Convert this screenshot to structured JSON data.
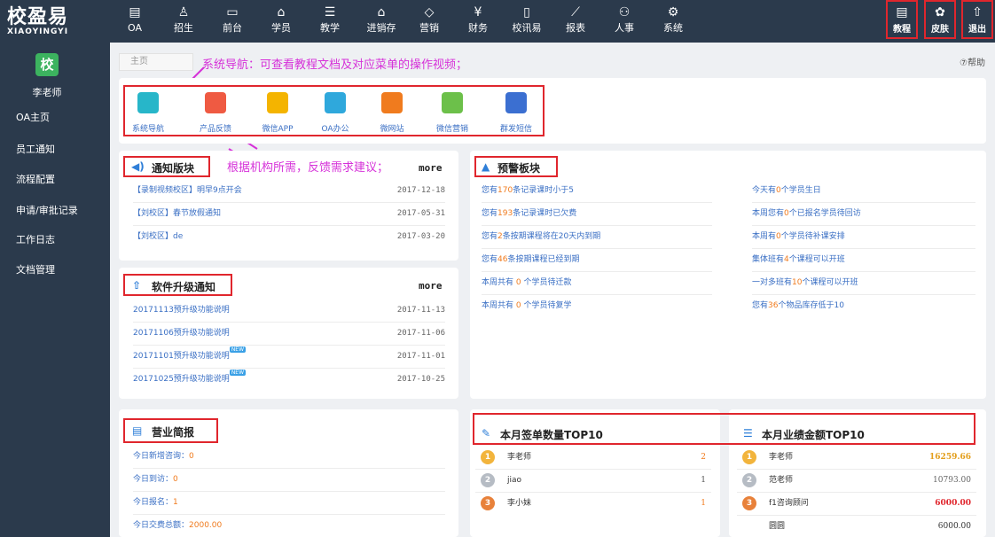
{
  "logo": {
    "name": "校盈易",
    "sub": "XIAOYINGYI"
  },
  "nav": [
    {
      "label": "OA",
      "icon": "contacts-icon"
    },
    {
      "label": "招生",
      "icon": "users-icon"
    },
    {
      "label": "前台",
      "icon": "monitor-icon"
    },
    {
      "label": "学员",
      "icon": "graduation-cap-icon"
    },
    {
      "label": "教学",
      "icon": "book-icon"
    },
    {
      "label": "进销存",
      "icon": "warehouse-icon"
    },
    {
      "label": "营销",
      "icon": "tag-icon"
    },
    {
      "label": "财务",
      "icon": "yen-icon"
    },
    {
      "label": "校讯易",
      "icon": "phone-icon"
    },
    {
      "label": "报表",
      "icon": "chart-icon"
    },
    {
      "label": "人事",
      "icon": "people-icon"
    },
    {
      "label": "系统",
      "icon": "gear-icon"
    }
  ],
  "right_buttons": [
    {
      "label": "教程",
      "icon": "tutorial-icon"
    },
    {
      "label": "皮肤",
      "icon": "palette-icon"
    },
    {
      "label": "退出",
      "icon": "logout-icon"
    }
  ],
  "sidebar": {
    "avatar": "校",
    "user": "李老师",
    "items": [
      "OA主页",
      "员工通知",
      "流程配置",
      "申请/审批记录",
      "工作日志",
      "文档管理"
    ]
  },
  "breadcrumb": "主页",
  "help": "⑦帮助",
  "annotations": {
    "top": "系统导航：可查看教程文档及对应菜单的操作视频；",
    "middle": "根据机构所需，反馈需求建议；"
  },
  "quick": [
    {
      "label": "系统导航",
      "color": "#27b6c9",
      "icon": "grid-icon"
    },
    {
      "label": "产品反馈",
      "color": "#ef5a42",
      "icon": "edit-icon"
    },
    {
      "label": "微信APP",
      "color": "#f4b400",
      "icon": "mobile-icon"
    },
    {
      "label": "OA办公",
      "color": "#2fa8dc",
      "icon": "briefcase-icon"
    },
    {
      "label": "微网站",
      "color": "#f07b1e",
      "icon": "monitor-icon"
    },
    {
      "label": "微信营销",
      "color": "#6cc04a",
      "icon": "wechat-icon"
    },
    {
      "label": "群发短信",
      "color": "#3b6fd1",
      "icon": "mail-icon"
    }
  ],
  "notice": {
    "title": "通知版块",
    "more": "more",
    "rows": [
      {
        "text": "【录制视频校区】明早9点开会",
        "date": "2017-12-18"
      },
      {
        "text": "【刘校区】春节放假通知",
        "date": "2017-05-31"
      },
      {
        "text": "【刘校区】de",
        "date": "2017-03-20"
      }
    ]
  },
  "upgrade": {
    "title": "软件升级通知",
    "more": "more",
    "rows": [
      {
        "text": "20171113预升级功能说明",
        "date": "2017-11-13",
        "new": false
      },
      {
        "text": "20171106预升级功能说明",
        "date": "2017-11-06",
        "new": false
      },
      {
        "text": "20171101预升级功能说明",
        "date": "2017-11-01",
        "new": true
      },
      {
        "text": "20171025预升级功能说明",
        "date": "2017-10-25",
        "new": true
      }
    ],
    "new_badge": "NEW"
  },
  "warning": {
    "title": "预警板块",
    "left": [
      {
        "pre": "您有",
        "num": "170",
        "post": "条记录课时小于5"
      },
      {
        "pre": "您有",
        "num": "193",
        "post": "条记录课时已欠费"
      },
      {
        "pre": "您有",
        "num": "2",
        "post": "条按期课程将在20天内到期"
      },
      {
        "pre": "您有",
        "num": "46",
        "post": "条按期课程已经到期"
      },
      {
        "pre": "本周共有 ",
        "num": "0",
        "post": " 个学员待迁款"
      },
      {
        "pre": "本周共有 ",
        "num": "0",
        "post": " 个学员待复学"
      }
    ],
    "right": [
      {
        "pre": "今天有",
        "num": "0",
        "post": "个学员生日"
      },
      {
        "pre": "本周您有",
        "num": "0",
        "post": "个已报名学员待回访"
      },
      {
        "pre": "本周有",
        "num": "0",
        "post": "个学员待补课安排"
      },
      {
        "pre": "集体班有",
        "num": "4",
        "post": "个课程可以开班"
      },
      {
        "pre": "一对多班有",
        "num": "10",
        "post": "个课程可以开班"
      },
      {
        "pre": "您有",
        "num": "36",
        "post": "个物品库存低于10"
      }
    ]
  },
  "brief": {
    "title": "营业简报",
    "rows": [
      {
        "label": "今日新增咨询：",
        "value": "0"
      },
      {
        "label": "今日到访：",
        "value": "0"
      },
      {
        "label": "今日报名：",
        "value": "1"
      },
      {
        "label": "今日交费总额：",
        "value": "2000.00"
      }
    ]
  },
  "sign_top": {
    "title": "本月签单数量TOP10",
    "rows": [
      {
        "name": "李老师",
        "value": "2",
        "highlight": true
      },
      {
        "name": "jiao",
        "value": "1",
        "highlight": false
      },
      {
        "name": "李小妹",
        "value": "1",
        "highlight": true
      }
    ]
  },
  "amount_top": {
    "title": "本月业绩金额TOP10",
    "rows": [
      {
        "name": "李老师",
        "value": "16259.66",
        "highlight": true
      },
      {
        "name": "范老师",
        "value": "10793.00",
        "highlight": false
      },
      {
        "name": "f1咨询顾问",
        "value": "6000.00",
        "highlight": true
      },
      {
        "name": "圆圆",
        "value": "6000.00",
        "highlight": false
      }
    ]
  },
  "colors": {
    "accent_red": "#e0262d",
    "annotation": "#d631d9",
    "link": "#3a6fc4",
    "number": "#f07b1e",
    "topbar": "#2b3a4c"
  }
}
